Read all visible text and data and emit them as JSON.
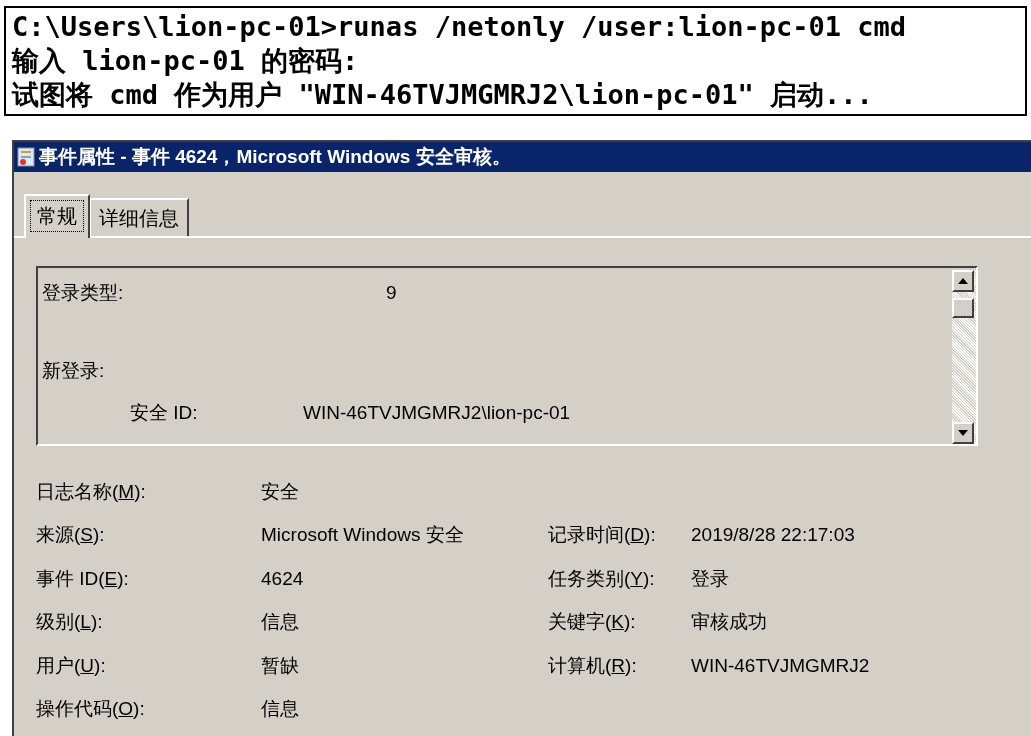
{
  "console": {
    "lines": [
      "C:\\Users\\lion-pc-01>runas /netonly /user:lion-pc-01 cmd",
      "输入 lion-pc-01 的密码:",
      "试图将 cmd 作为用户 \"WIN-46TVJMGMRJ2\\lion-pc-01\" 启动..."
    ]
  },
  "window": {
    "title": "事件属性 - 事件 4624，Microsoft Windows 安全审核。"
  },
  "tabs": [
    {
      "label": "常规",
      "selected": true
    },
    {
      "label": "详细信息",
      "selected": false
    }
  ],
  "description": {
    "rows": [
      {
        "kind": "field",
        "label": "登录类型:",
        "value": "9"
      },
      {
        "kind": "heading",
        "label": "新登录:"
      },
      {
        "kind": "subfield",
        "label": "安全 ID:",
        "value": "WIN-46TVJMGMRJ2\\lion-pc-01"
      }
    ]
  },
  "fields": [
    {
      "label_before": "日志名称(",
      "key": "M",
      "label_after": "):",
      "value": "安全"
    },
    {
      "label_before": "来源(",
      "key": "S",
      "label_after": "):",
      "value": "Microsoft Windows 安全",
      "label2_before": "记录时间(",
      "key2": "D",
      "label2_after": "):",
      "value2": "2019/8/28 22:17:03"
    },
    {
      "label_before": "事件 ID(",
      "key": "E",
      "label_after": "):",
      "value": "4624",
      "label2_before": "任务类别(",
      "key2": "Y",
      "label2_after": "):",
      "value2": "登录"
    },
    {
      "label_before": "级别(",
      "key": "L",
      "label_after": "):",
      "value": "信息",
      "label2_before": "关键字(",
      "key2": "K",
      "label2_after": "):",
      "value2": "审核成功"
    },
    {
      "label_before": "用户(",
      "key": "U",
      "label_after": "):",
      "value": "暂缺",
      "label2_before": "计算机(",
      "key2": "R",
      "label2_after": "):",
      "value2": "WIN-46TVJMGMRJ2"
    },
    {
      "label_before": "操作代码(",
      "key": "O",
      "label_after": "):",
      "value": "信息"
    }
  ]
}
